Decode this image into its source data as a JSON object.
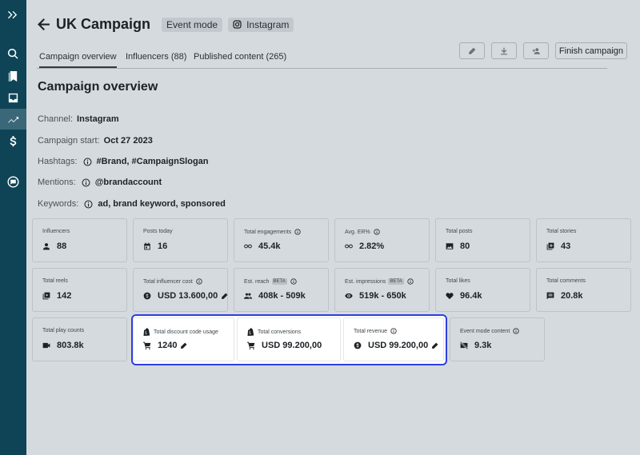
{
  "header": {
    "title": "UK Campaign",
    "badges": [
      "Event mode",
      "Instagram"
    ]
  },
  "tabs": [
    "Campaign overview",
    "Influencers (88)",
    "Published content (265)"
  ],
  "actions": {
    "finish_label": "Finish campaign"
  },
  "overview": {
    "section_title": "Campaign overview",
    "channel": {
      "label": "Channel:",
      "value": "Instagram"
    },
    "start": {
      "label": "Campaign start:",
      "value": "Oct 27 2023"
    },
    "hashtags": {
      "label": "Hashtags:",
      "value": "#Brand, #CampaignSlogan"
    },
    "mentions": {
      "label": "Mentions:",
      "value": "@brandaccount"
    },
    "keywords": {
      "label": "Keywords:",
      "value": "ad, brand keyword, sponsored"
    }
  },
  "stats": [
    {
      "label": "Influencers",
      "value": "88"
    },
    {
      "label": "Posts today",
      "value": "16"
    },
    {
      "label": "Total engagements",
      "value": "45.4k"
    },
    {
      "label": "Avg. ER%",
      "value": "2.82%"
    },
    {
      "label": "Total posts",
      "value": "80"
    },
    {
      "label": "Total stories",
      "value": "43"
    },
    {
      "label": "Total reels",
      "value": "142"
    },
    {
      "label": "Total influencer cost",
      "value": "USD 13.600,00"
    },
    {
      "label": "Est. reach",
      "value": "408k - 509k",
      "badge": "BETA"
    },
    {
      "label": "Est. impressions",
      "value": "519k - 650k",
      "badge": "BETA"
    },
    {
      "label": "Total likes",
      "value": "96.4k"
    },
    {
      "label": "Total comments",
      "value": "20.8k"
    },
    {
      "label": "Total play counts",
      "value": "803.8k"
    },
    {
      "label": "Total discount code usage",
      "value": "1240"
    },
    {
      "label": "Total conversions",
      "value": "USD 99.200,00"
    },
    {
      "label": "Total revenue",
      "value": "USD 99.200,00"
    },
    {
      "label": "Event mode content",
      "value": "9.3k"
    }
  ],
  "colors": {
    "sidebar": "#0e4456",
    "highlight": "#2f3fe0"
  }
}
